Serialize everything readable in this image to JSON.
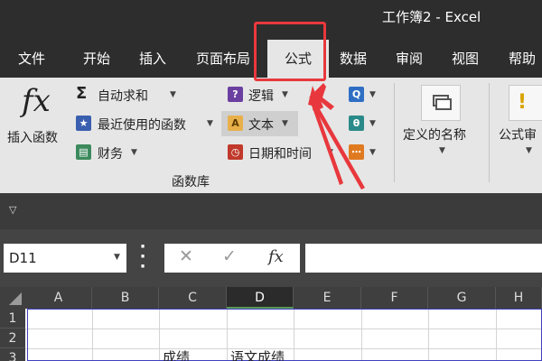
{
  "window": {
    "title": "工作簿2 - Excel"
  },
  "tabs": [
    {
      "label": "文件"
    },
    {
      "label": "开始"
    },
    {
      "label": "插入"
    },
    {
      "label": "页面布局"
    },
    {
      "label": "公式"
    },
    {
      "label": "数据"
    },
    {
      "label": "审阅"
    },
    {
      "label": "视图"
    },
    {
      "label": "帮助"
    }
  ],
  "ribbon": {
    "insert_function": "插入函数",
    "autosum": "自动求和",
    "recent": "最近使用的函数",
    "financial": "财务",
    "logical": "逻辑",
    "text": "文本",
    "datetime": "日期和时间",
    "group_label": "函数库",
    "defined_names": "定义的名称",
    "formula_audit": "公式审"
  },
  "formula_bar": {
    "name_box": "D11",
    "fx_label": "fx",
    "value": ""
  },
  "grid": {
    "columns": [
      "A",
      "B",
      "C",
      "D",
      "E",
      "F",
      "G",
      "H"
    ],
    "selected_column": "D",
    "rows": [
      "1",
      "2",
      "3"
    ],
    "cells": {
      "C3": "成绩",
      "D3": "语文成绩"
    }
  },
  "colors": {
    "accent_red": "#e8383d",
    "dark_bg": "#2d2d2d",
    "ribbon_bg": "#e6e6e6"
  }
}
